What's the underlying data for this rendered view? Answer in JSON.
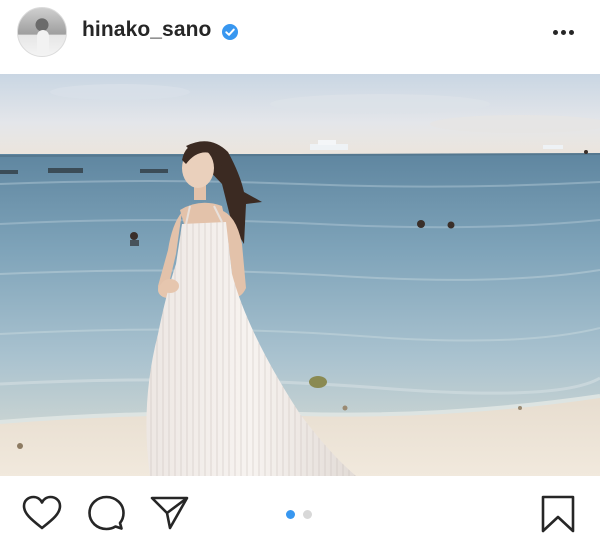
{
  "post": {
    "username": "hinako_sano",
    "verified": true,
    "verified_color": "#3897f0"
  },
  "icons": {
    "more": "more-options-icon",
    "like": "heart-icon",
    "comment": "comment-icon",
    "share": "send-icon",
    "save": "bookmark-icon"
  },
  "carousel": {
    "current": 1,
    "total": 2,
    "active_color": "#3897f0",
    "inactive_color": "#d8d8d8"
  }
}
